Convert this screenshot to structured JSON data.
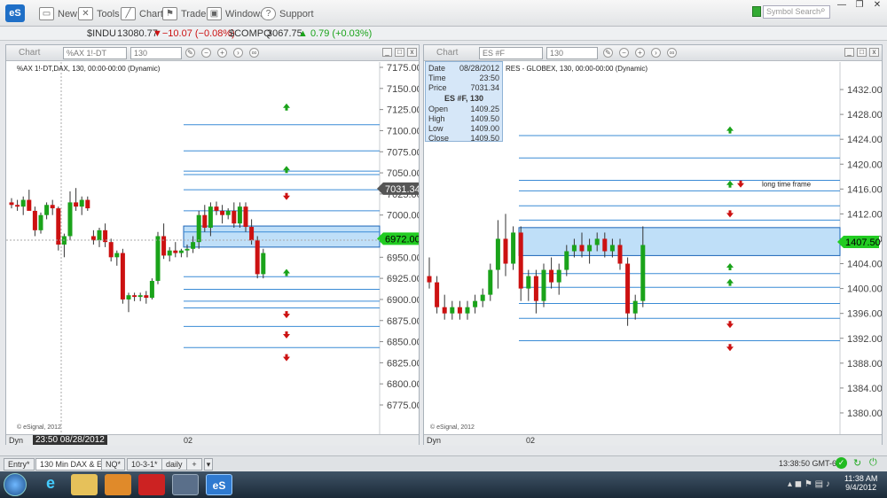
{
  "toolbar": {
    "logo": "eS",
    "new": "New",
    "tools": "Tools",
    "chart": "Chart",
    "trade": "Trade",
    "windows": "Windows",
    "support": "Support",
    "search_placeholder": "Symbol Search"
  },
  "ticker": [
    {
      "symbol": "$INDU",
      "last": "13080.77",
      "change": "▼−10.07 (−0.08%)",
      "dir": "down"
    },
    {
      "symbol": "$COMPQ",
      "last": "3067.75",
      "change": "▲ 0.79 (+0.03%)",
      "dir": "up"
    }
  ],
  "colors": {
    "up": "#1aa31a",
    "down": "#cc1111",
    "zone": "#a9d4f5",
    "zone_line": "#1c66b8",
    "level": "#3a8bd6",
    "price_tag_green": "#22cc22"
  },
  "chart_left": {
    "header_title": "Chart",
    "symbol_field": "%AX 1!-DT",
    "interval_field": "130",
    "symbol_line": "%AX 1!-DT,DAX, 130, 00:00-00:00 (Dynamic)",
    "esignal": "© eSignal, 2012",
    "dyn_label": "Dyn",
    "cursor_time": "23:50 08/28/2012",
    "x_tick": "02",
    "last_price_tag": "7031.34",
    "current_price_tag": "6972.00",
    "y_labels": [
      "7175.00",
      "7150.00",
      "7125.00",
      "7100.00",
      "7075.00",
      "7050.00",
      "7025.00",
      "7000.00",
      "6975.00",
      "6950.00",
      "6925.00",
      "6900.00",
      "6875.00",
      "6850.00",
      "6825.00",
      "6800.00",
      "6775.00"
    ],
    "y_range": [
      6775,
      7175
    ],
    "zone": [
      6962,
      6987
    ],
    "levels": [
      7107,
      7076,
      7052,
      7048,
      7030,
      7005,
      6980,
      6927,
      6912,
      6898,
      6890,
      6868,
      6843
    ],
    "arrows": [
      {
        "x": 322,
        "v": 7128,
        "dir": "up"
      },
      {
        "x": 322,
        "v": 7054,
        "dir": "up"
      },
      {
        "x": 322,
        "v": 7022,
        "dir": "down"
      },
      {
        "x": 322,
        "v": 6932,
        "dir": "up"
      },
      {
        "x": 322,
        "v": 6882,
        "dir": "down"
      },
      {
        "x": 322,
        "v": 6858,
        "dir": "down"
      },
      {
        "x": 322,
        "v": 6831,
        "dir": "down"
      }
    ],
    "candles": [
      [
        7015,
        7020,
        7008,
        7012
      ],
      [
        7012,
        7018,
        7005,
        7010
      ],
      [
        7010,
        7022,
        7000,
        7018
      ],
      [
        7018,
        7030,
        7012,
        7005
      ],
      [
        7005,
        7010,
        6975,
        6982
      ],
      [
        6982,
        7003,
        6978,
        7000
      ],
      [
        7000,
        7015,
        6995,
        7012
      ],
      [
        7012,
        7018,
        7000,
        7008
      ],
      [
        7008,
        7010,
        6958,
        6965
      ],
      [
        6965,
        6978,
        6950,
        6975
      ],
      [
        6975,
        7028,
        6970,
        7015
      ],
      [
        7015,
        7032,
        7005,
        7010
      ],
      [
        7010,
        7022,
        7000,
        7018
      ],
      [
        7018,
        7022,
        7005,
        7008
      ],
      [
        6975,
        6982,
        6965,
        6970
      ],
      [
        6970,
        6985,
        6962,
        6982
      ],
      [
        6982,
        6990,
        6962,
        6968
      ],
      [
        6968,
        6972,
        6945,
        6950
      ],
      [
        6950,
        6958,
        6940,
        6955
      ],
      [
        6955,
        6960,
        6895,
        6900
      ],
      [
        6900,
        6908,
        6885,
        6905
      ],
      [
        6905,
        6908,
        6898,
        6903
      ],
      [
        6903,
        6908,
        6898,
        6905
      ],
      [
        6905,
        6910,
        6895,
        6902
      ],
      [
        6902,
        6925,
        6900,
        6922
      ],
      [
        6922,
        6980,
        6918,
        6975
      ],
      [
        6975,
        6990,
        6948,
        6952
      ],
      [
        6952,
        6962,
        6945,
        6958
      ],
      [
        6958,
        6968,
        6950,
        6955
      ],
      [
        6955,
        6960,
        6950,
        6958
      ],
      [
        6958,
        6965,
        6950,
        6960
      ],
      [
        6960,
        6975,
        6955,
        6968
      ],
      [
        6968,
        7005,
        6960,
        7000
      ],
      [
        7000,
        7012,
        6980,
        6985
      ],
      [
        6985,
        7015,
        6975,
        7010
      ],
      [
        7010,
        7016,
        7000,
        7005
      ],
      [
        7005,
        7012,
        6990,
        7000
      ],
      [
        7000,
        7008,
        6995,
        7005
      ],
      [
        7005,
        7015,
        6985,
        6990
      ],
      [
        6990,
        7015,
        6985,
        7010
      ],
      [
        7010,
        7015,
        6980,
        6986
      ],
      [
        6986,
        6995,
        6965,
        6970
      ],
      [
        6970,
        6975,
        6925,
        6930
      ],
      [
        6930,
        6960,
        6925,
        6955
      ]
    ]
  },
  "chart_right": {
    "header_title": "Chart",
    "symbol_field": "ES #F",
    "interval_field": "130",
    "symbol_line_visible": "RES - GLOBEX, 130, 00:00-00:00 (Dynamic)",
    "esignal": "© eSignal, 2012",
    "dyn_label": "Dyn",
    "x_tick": "02",
    "current_price_tag": "1407.50",
    "annotation": "long time frame",
    "y_labels": [
      "1432.00",
      "1428.00",
      "1424.00",
      "1420.00",
      "1416.00",
      "1412.00",
      "1408.00",
      "1404.00",
      "1400.00",
      "1396.00",
      "1392.00",
      "1388.00",
      "1384.00",
      "1380.00"
    ],
    "y_range": [
      1378,
      1434
    ],
    "zone": [
      1405.3,
      1409.8
    ],
    "levels": [
      1424.6,
      1421.0,
      1417.4,
      1415.7,
      1413.3,
      1411.0,
      1402.4,
      1400.2,
      1397.6,
      1395.2,
      1391.6
    ],
    "arrows": [
      {
        "x": 822,
        "v": 1425.5,
        "dir": "up"
      },
      {
        "x": 822,
        "v": 1416.8,
        "dir": "up"
      },
      {
        "x": 834,
        "v": 1416.8,
        "dir": "down"
      },
      {
        "x": 822,
        "v": 1412.0,
        "dir": "down"
      },
      {
        "x": 822,
        "v": 1403.5,
        "dir": "up"
      },
      {
        "x": 822,
        "v": 1401.0,
        "dir": "up"
      },
      {
        "x": 822,
        "v": 1394.2,
        "dir": "down"
      },
      {
        "x": 822,
        "v": 1390.5,
        "dir": "down"
      }
    ],
    "candles": [
      [
        1402,
        1405,
        1400,
        1401
      ],
      [
        1401,
        1402,
        1396,
        1397
      ],
      [
        1397,
        1399,
        1395,
        1396
      ],
      [
        1396,
        1398,
        1395,
        1397
      ],
      [
        1397,
        1398,
        1395,
        1396
      ],
      [
        1396,
        1398,
        1395,
        1397
      ],
      [
        1397,
        1399,
        1396,
        1398
      ],
      [
        1398,
        1400,
        1397,
        1399
      ],
      [
        1399,
        1404,
        1398,
        1403
      ],
      [
        1403,
        1411,
        1400,
        1408
      ],
      [
        1408,
        1412,
        1402,
        1404
      ],
      [
        1404,
        1410,
        1403,
        1409
      ],
      [
        1409,
        1410,
        1398,
        1400
      ],
      [
        1400,
        1403,
        1398,
        1402
      ],
      [
        1402,
        1403,
        1396,
        1398
      ],
      [
        1398,
        1404,
        1397,
        1403
      ],
      [
        1403,
        1405,
        1400,
        1401
      ],
      [
        1401,
        1404,
        1399,
        1403
      ],
      [
        1403,
        1407,
        1402,
        1406
      ],
      [
        1406,
        1408,
        1405,
        1407
      ],
      [
        1407,
        1409,
        1405,
        1406
      ],
      [
        1406,
        1408,
        1404,
        1407
      ],
      [
        1407,
        1409,
        1406,
        1408
      ],
      [
        1408,
        1409,
        1405,
        1406
      ],
      [
        1406,
        1408,
        1405,
        1407
      ],
      [
        1407,
        1408,
        1403,
        1404
      ],
      [
        1404,
        1405,
        1394,
        1396
      ],
      [
        1396,
        1399,
        1395,
        1398
      ],
      [
        1398,
        1410,
        1397,
        1407
      ]
    ]
  },
  "infobox": {
    "date_label": "Date",
    "date": "08/28/2012",
    "time_label": "Time",
    "time": "23:50",
    "price_label": "Price",
    "price": "7031.34",
    "title": "ES #F, 130",
    "open_label": "Open",
    "open": "1409.25",
    "high_label": "High",
    "high": "1409.50",
    "low_label": "Low",
    "low": "1409.00",
    "close_label": "Close",
    "close": "1409.50"
  },
  "tabs": [
    "Entry*",
    "130 Min DAX & ES*",
    "NQ*",
    "10-3-1*",
    "daily",
    "+"
  ],
  "status_right": "13:38:50 GMT-6",
  "clock": {
    "time": "11:38 AM",
    "date": "9/4/2012"
  }
}
